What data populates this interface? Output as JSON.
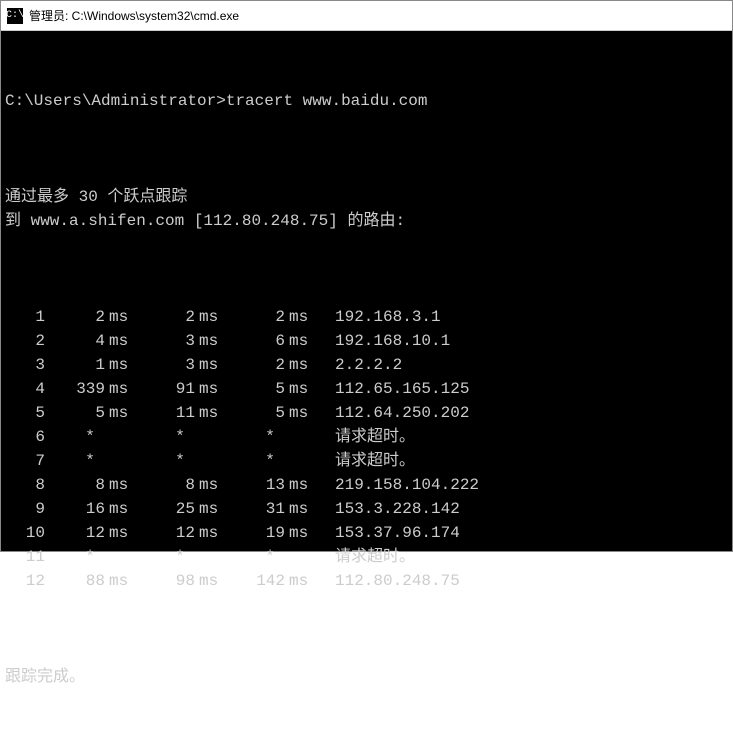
{
  "window": {
    "title": "管理员: C:\\Windows\\system32\\cmd.exe",
    "icon_label": "C:\\"
  },
  "terminal": {
    "prompt": "C:\\Users\\Administrator>",
    "command": "tracert www.baidu.com",
    "header_line1": "通过最多 30 个跃点跟踪",
    "header_line2": "到 www.a.shifen.com [112.80.248.75] 的路由:",
    "footer": "跟踪完成。",
    "timeout_text": "请求超时。",
    "hops": [
      {
        "n": "1",
        "t1": "2",
        "u1": "ms",
        "t2": "2",
        "u2": "ms",
        "t3": "2",
        "u3": "ms",
        "host": "192.168.3.1"
      },
      {
        "n": "2",
        "t1": "4",
        "u1": "ms",
        "t2": "3",
        "u2": "ms",
        "t3": "6",
        "u3": "ms",
        "host": "192.168.10.1"
      },
      {
        "n": "3",
        "t1": "1",
        "u1": "ms",
        "t2": "3",
        "u2": "ms",
        "t3": "2",
        "u3": "ms",
        "host": "2.2.2.2"
      },
      {
        "n": "4",
        "t1": "339",
        "u1": "ms",
        "t2": "91",
        "u2": "ms",
        "t3": "5",
        "u3": "ms",
        "host": "112.65.165.125"
      },
      {
        "n": "5",
        "t1": "5",
        "u1": "ms",
        "t2": "11",
        "u2": "ms",
        "t3": "5",
        "u3": "ms",
        "host": "112.64.250.202"
      },
      {
        "n": "6",
        "t1": "*",
        "u1": "",
        "t2": "*",
        "u2": "",
        "t3": "*",
        "u3": "",
        "host": "请求超时。"
      },
      {
        "n": "7",
        "t1": "*",
        "u1": "",
        "t2": "*",
        "u2": "",
        "t3": "*",
        "u3": "",
        "host": "请求超时。"
      },
      {
        "n": "8",
        "t1": "8",
        "u1": "ms",
        "t2": "8",
        "u2": "ms",
        "t3": "13",
        "u3": "ms",
        "host": "219.158.104.222"
      },
      {
        "n": "9",
        "t1": "16",
        "u1": "ms",
        "t2": "25",
        "u2": "ms",
        "t3": "31",
        "u3": "ms",
        "host": "153.3.228.142"
      },
      {
        "n": "10",
        "t1": "12",
        "u1": "ms",
        "t2": "12",
        "u2": "ms",
        "t3": "19",
        "u3": "ms",
        "host": "153.37.96.174"
      },
      {
        "n": "11",
        "t1": "*",
        "u1": "",
        "t2": "*",
        "u2": "",
        "t3": "*",
        "u3": "",
        "host": "请求超时。"
      },
      {
        "n": "12",
        "t1": "88",
        "u1": "ms",
        "t2": "98",
        "u2": "ms",
        "t3": "142",
        "u3": "ms",
        "host": "112.80.248.75"
      }
    ]
  }
}
